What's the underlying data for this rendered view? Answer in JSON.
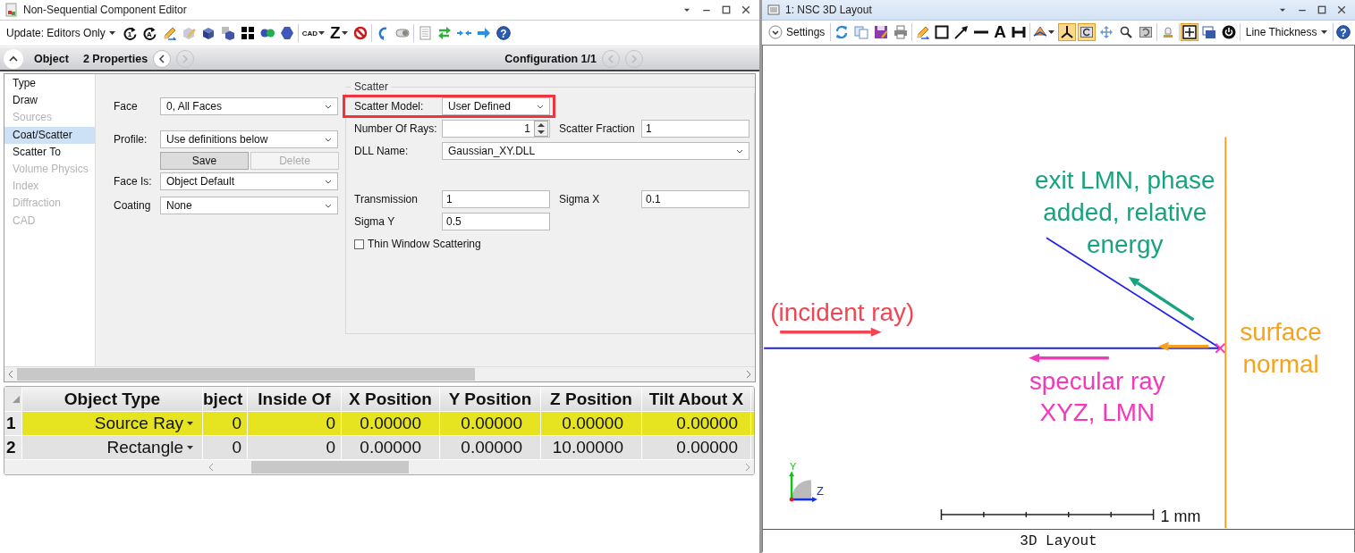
{
  "editor": {
    "title": "Non-Sequential Component Editor",
    "toolbar": [
      {
        "kind": "dropdown",
        "label": "Update: Editors Only"
      },
      {
        "kind": "cycle",
        "text": "1"
      },
      {
        "kind": "cycle",
        "text": "A"
      },
      {
        "kind": "pencil"
      },
      {
        "kind": "cube-pencil"
      },
      {
        "kind": "cube"
      },
      {
        "kind": "cubes"
      },
      {
        "kind": "grid"
      },
      {
        "kind": "dots"
      },
      {
        "kind": "hexagon"
      },
      {
        "kind": "separator"
      },
      {
        "kind": "tag",
        "text": "CAD",
        "dropdown": true
      },
      {
        "kind": "glyph",
        "text": "Z",
        "dropdown": true
      },
      {
        "kind": "nosign"
      },
      {
        "kind": "separator"
      },
      {
        "kind": "undo"
      },
      {
        "kind": "toggle"
      },
      {
        "kind": "separator"
      },
      {
        "kind": "document"
      },
      {
        "kind": "swap"
      },
      {
        "kind": "converge"
      },
      {
        "kind": "forward"
      },
      {
        "kind": "help",
        "text": "?"
      }
    ],
    "object_bar": {
      "label": "Object",
      "count": "2 Properties",
      "configuration": "Configuration 1/1",
      "object_nav": [
        {
          "disabled": false
        },
        {
          "disabled": true
        }
      ],
      "config_nav": [
        {
          "disabled": true
        },
        {
          "disabled": true
        }
      ]
    },
    "sections": [
      {
        "label": "Type",
        "selected": false,
        "disabled": false
      },
      {
        "label": "Draw",
        "selected": false,
        "disabled": false
      },
      {
        "label": "Sources",
        "selected": false,
        "disabled": true
      },
      {
        "label": "Coat/Scatter",
        "selected": true,
        "disabled": false
      },
      {
        "label": "Scatter To",
        "selected": false,
        "disabled": false
      },
      {
        "label": "Volume Physics",
        "selected": false,
        "disabled": true
      },
      {
        "label": "Index",
        "selected": false,
        "disabled": true
      },
      {
        "label": "Diffraction",
        "selected": false,
        "disabled": true
      },
      {
        "label": "CAD",
        "selected": false,
        "disabled": true
      }
    ],
    "fields": [
      {
        "kind": "select",
        "label": "Face",
        "value": "0, All Faces"
      },
      {
        "kind": "select",
        "label": "Profile:",
        "value": "Use definitions below"
      },
      {
        "kind": "buttons",
        "buttons": [
          {
            "label": "Save",
            "disabled": false
          },
          {
            "label": "Delete",
            "disabled": true
          }
        ]
      },
      {
        "kind": "select",
        "label": "Face Is:",
        "value": "Object Default"
      },
      {
        "kind": "select",
        "label": "Coating",
        "value": "None"
      }
    ],
    "scatter": {
      "title": "Scatter",
      "model": {
        "label": "Scatter Model:",
        "value": "User Defined",
        "highlighted": true
      },
      "rays": {
        "label": "Number Of Rays:",
        "value": "1"
      },
      "fraction": {
        "label": "Scatter Fraction",
        "value": "1"
      },
      "dll": {
        "label": "DLL Name:",
        "value": "Gaussian_XY.DLL"
      },
      "params": [
        {
          "label": "Transmission",
          "value": "1"
        },
        {
          "label": "Sigma X",
          "value": "0.1"
        },
        {
          "label": "Sigma Y",
          "value": "0.5"
        }
      ],
      "thin_window": {
        "label": "Thin Window Scattering",
        "checked": false
      }
    },
    "table": {
      "columns": [
        "Object Type",
        "bject",
        "Inside Of",
        "X Position",
        "Y Position",
        "Z Position",
        "Tilt About X"
      ],
      "rows": [
        {
          "number": "1",
          "selected": true,
          "cells": [
            "Source Ray",
            "0",
            "0",
            "0.00000",
            "0.00000",
            "0.00000",
            "0.00000"
          ]
        },
        {
          "number": "2",
          "selected": false,
          "cells": [
            "Rectangle",
            "0",
            "0",
            "0.00000",
            "0.00000",
            "10.00000",
            "0.00000"
          ]
        }
      ]
    }
  },
  "layout": {
    "title": "1: NSC 3D Layout",
    "toolbar": [
      {
        "kind": "expander",
        "label": "Settings",
        "pressed": false
      },
      {
        "kind": "separator"
      },
      {
        "kind": "refresh",
        "pressed": false
      },
      {
        "kind": "copy",
        "pressed": false
      },
      {
        "kind": "save",
        "pressed": false
      },
      {
        "kind": "print",
        "pressed": false
      },
      {
        "kind": "separator"
      },
      {
        "kind": "pencil",
        "pressed": false
      },
      {
        "kind": "rectangle",
        "pressed": false
      },
      {
        "kind": "arrow",
        "pressed": false
      },
      {
        "kind": "line",
        "pressed": false
      },
      {
        "kind": "glyph",
        "text": "A",
        "pressed": false
      },
      {
        "kind": "dimension",
        "pressed": false
      },
      {
        "kind": "separator"
      },
      {
        "kind": "view",
        "dropdown": true,
        "pressed": false
      },
      {
        "kind": "axes",
        "pressed": true
      },
      {
        "kind": "rotate",
        "pressed": true
      },
      {
        "kind": "move",
        "pressed": false
      },
      {
        "kind": "search",
        "pressed": false
      },
      {
        "kind": "reset",
        "pressed": false
      },
      {
        "kind": "separator"
      },
      {
        "kind": "lamp",
        "pressed": false
      },
      {
        "kind": "separator"
      },
      {
        "kind": "fit",
        "pressed": true
      },
      {
        "kind": "windows",
        "pressed": false
      },
      {
        "kind": "power",
        "pressed": false
      },
      {
        "kind": "separator"
      },
      {
        "kind": "dropdown",
        "label": "Line Thickness",
        "pressed": false
      },
      {
        "kind": "separator"
      },
      {
        "kind": "help",
        "text": "?",
        "pressed": false
      }
    ],
    "annotations": [
      {
        "lines": [
          "(incident ray)"
        ],
        "color": "#f04654"
      },
      {
        "lines": [
          "exit LMN, phase",
          "added, relative",
          "energy"
        ],
        "color": "#17a37f"
      },
      {
        "lines": [
          "surface",
          "normal"
        ],
        "color": "#f5a21c"
      },
      {
        "lines": [
          "specular ray",
          "XYZ, LMN"
        ],
        "color": "#f238bb"
      }
    ],
    "axes": [
      "Y",
      "Z"
    ],
    "scale_label": "1 mm",
    "footer": "3D Layout"
  }
}
